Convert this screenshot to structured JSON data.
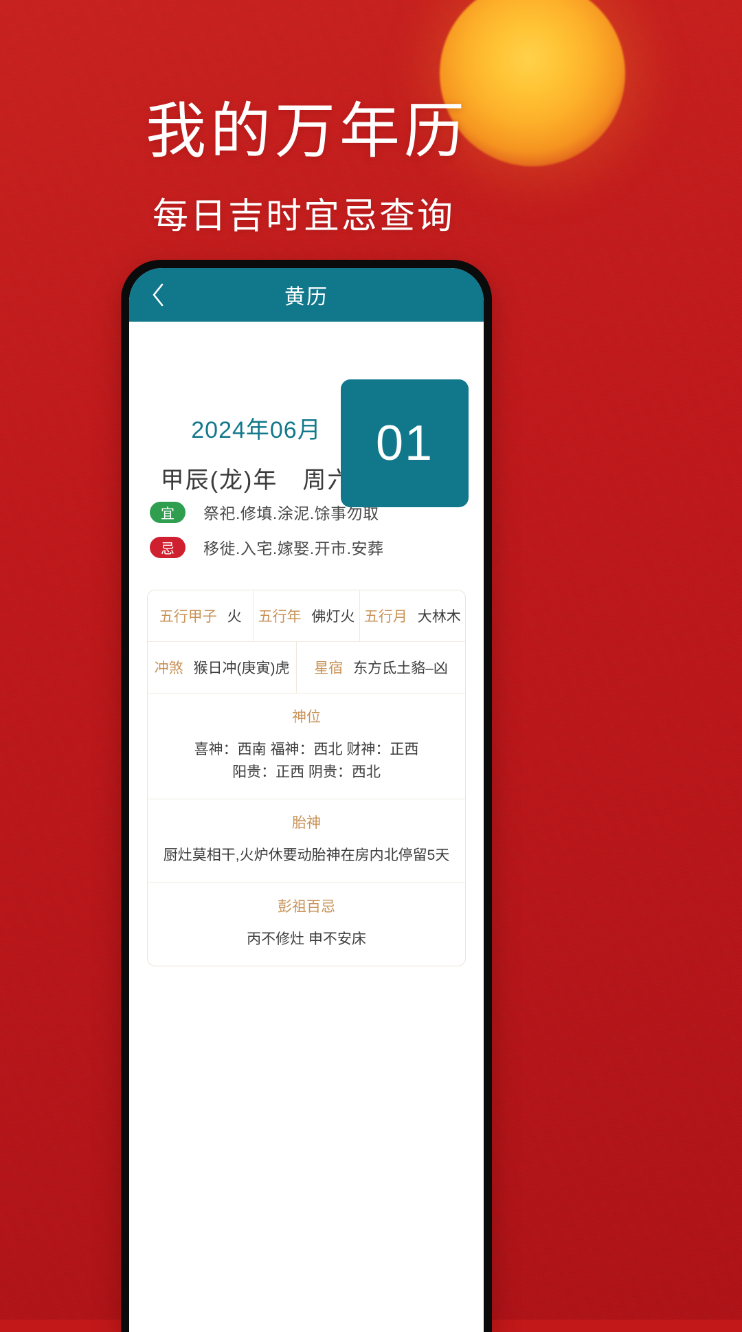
{
  "theme": {
    "bg_red": "#c0171a",
    "sun_yellow": "#ffc436",
    "teal": "#11788c",
    "gold_label": "#c89257",
    "green_badge": "#2f9e4f",
    "red_badge": "#cf2030"
  },
  "hero": {
    "title": "我的万年历",
    "subtitle": "每日吉时宜忌查询"
  },
  "app": {
    "header": {
      "back_icon": "chevron-left-icon",
      "title": "黄历"
    },
    "date": {
      "year_month": "2024年06月",
      "ganzhi_weekday": "甲辰(龙)年　周六",
      "day": "01"
    },
    "yiji": [
      {
        "badge": "宜",
        "kind": "yi",
        "text": "祭祀.修填.涂泥.馀事勿取"
      },
      {
        "badge": "忌",
        "kind": "ji",
        "text": "移徙.入宅.嫁娶.开市.安葬"
      }
    ],
    "info_rows": [
      [
        {
          "label": "五行甲子",
          "value": "火"
        },
        {
          "label": "五行年",
          "value": "佛灯火"
        },
        {
          "label": "五行月",
          "value": "大林木"
        }
      ],
      [
        {
          "label": "冲煞",
          "value": "猴日冲(庚寅)虎"
        },
        {
          "label": "星宿",
          "value": "东方氐土貉–凶"
        }
      ]
    ],
    "info_blocks": [
      {
        "title": "神位",
        "line1": "喜神：西南 福神：西北 财神：正西",
        "line2": "阳贵：正西 阴贵：西北"
      },
      {
        "title": "胎神",
        "line1": "厨灶莫相干,火炉休要动胎神在房内北停留5天",
        "line2": ""
      },
      {
        "title": "彭祖百忌",
        "line1": "丙不修灶 申不安床",
        "line2": ""
      }
    ]
  }
}
